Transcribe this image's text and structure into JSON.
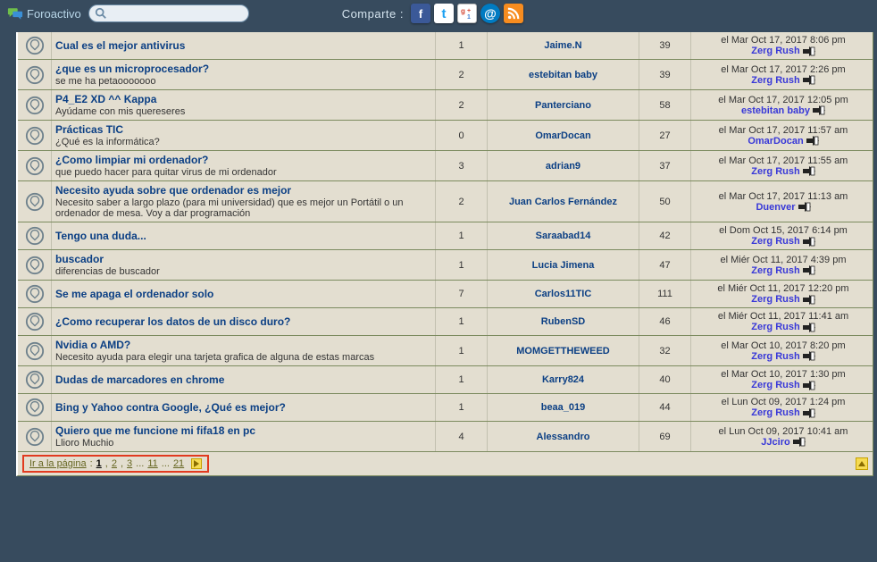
{
  "header": {
    "brand": "Foroactivo",
    "share_label": "Comparte :",
    "search_placeholder": ""
  },
  "topics": [
    {
      "title": "Cual es el mejor antivirus",
      "subtitle": "",
      "replies": 1,
      "author": "Jaime.N",
      "views": 39,
      "last_date": "el Mar Oct 17, 2017 8:06 pm",
      "last_by": "Zerg Rush"
    },
    {
      "title": "¿que es un microprocesador?",
      "subtitle": "se me ha petaooooooo",
      "replies": 2,
      "author": "estebitan baby",
      "views": 39,
      "last_date": "el Mar Oct 17, 2017 2:26 pm",
      "last_by": "Zerg Rush"
    },
    {
      "title": "P4_E2 XD ^^ Kappa",
      "subtitle": "Ayúdame con mis quereseres",
      "replies": 2,
      "author": "Panterciano",
      "views": 58,
      "last_date": "el Mar Oct 17, 2017 12:05 pm",
      "last_by": "estebitan baby"
    },
    {
      "title": "Prácticas TIC",
      "subtitle": "¿Qué es la informática?",
      "replies": 0,
      "author": "OmarDocan",
      "views": 27,
      "last_date": "el Mar Oct 17, 2017 11:57 am",
      "last_by": "OmarDocan"
    },
    {
      "title": "¿Como limpiar mi ordenador?",
      "subtitle": "que puedo hacer para quitar virus de mi ordenador",
      "replies": 3,
      "author": "adrian9",
      "views": 37,
      "last_date": "el Mar Oct 17, 2017 11:55 am",
      "last_by": "Zerg Rush"
    },
    {
      "title": "Necesito ayuda sobre que ordenador es mejor",
      "subtitle": "Necesito saber a largo plazo (para mi universidad) que es mejor un Portátil o un ordenador de mesa. Voy a dar programación",
      "replies": 2,
      "author": "Juan Carlos Fernández",
      "views": 50,
      "last_date": "el Mar Oct 17, 2017 11:13 am",
      "last_by": "Duenver"
    },
    {
      "title": "Tengo una duda...",
      "subtitle": "",
      "replies": 1,
      "author": "Saraabad14",
      "views": 42,
      "last_date": "el Dom Oct 15, 2017 6:14 pm",
      "last_by": "Zerg Rush"
    },
    {
      "title": "buscador",
      "subtitle": "diferencias de buscador",
      "replies": 1,
      "author": "Lucia Jimena",
      "views": 47,
      "last_date": "el Miér Oct 11, 2017 4:39 pm",
      "last_by": "Zerg Rush"
    },
    {
      "title": "Se me apaga el ordenador solo",
      "subtitle": "",
      "replies": 7,
      "author": "Carlos11TIC",
      "views": 111,
      "last_date": "el Miér Oct 11, 2017 12:20 pm",
      "last_by": "Zerg Rush"
    },
    {
      "title": "¿Como recuperar los datos de un disco duro?",
      "subtitle": "",
      "replies": 1,
      "author": "RubenSD",
      "views": 46,
      "last_date": "el Miér Oct 11, 2017 11:41 am",
      "last_by": "Zerg Rush"
    },
    {
      "title": "Nvidia o AMD?",
      "subtitle": "Necesito ayuda para elegir una tarjeta grafica de alguna de estas marcas",
      "replies": 1,
      "author": "MOMGETTHEWEED",
      "views": 32,
      "last_date": "el Mar Oct 10, 2017 8:20 pm",
      "last_by": "Zerg Rush"
    },
    {
      "title": "Dudas de marcadores en chrome",
      "subtitle": "",
      "replies": 1,
      "author": "Karry824",
      "views": 40,
      "last_date": "el Mar Oct 10, 2017 1:30 pm",
      "last_by": "Zerg Rush"
    },
    {
      "title": "Bing y Yahoo contra Google, ¿Qué es mejor?",
      "subtitle": "",
      "replies": 1,
      "author": "beaa_019",
      "views": 44,
      "last_date": "el Lun Oct 09, 2017 1:24 pm",
      "last_by": "Zerg Rush"
    },
    {
      "title": "Quiero que me funcione mi fifa18 en pc",
      "subtitle": "Llioro Muchio",
      "replies": 4,
      "author": "Alessandro",
      "views": 69,
      "last_date": "el Lun Oct 09, 2017 10:41 am",
      "last_by": "JJciro"
    }
  ],
  "pagination": {
    "label": "Ir a la página",
    "current": "1",
    "pages": [
      "2",
      "3"
    ],
    "sep": "...",
    "more": [
      "11"
    ],
    "last": "21"
  }
}
